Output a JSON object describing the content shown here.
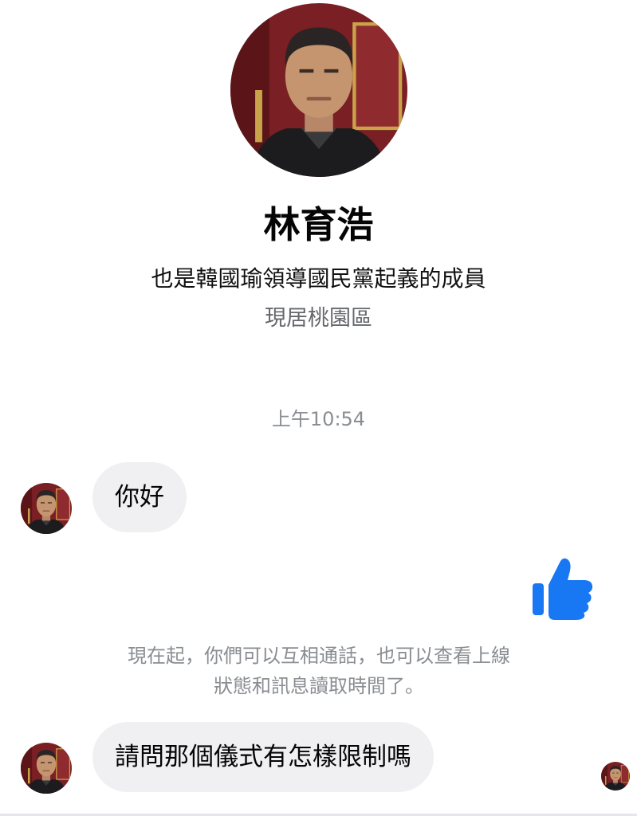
{
  "profile": {
    "name": "林育浩",
    "bio": "也是韓國瑜領導國民黨起義的成員",
    "location": "現居桃園區"
  },
  "conversation": {
    "timestamp": "上午10:54",
    "messages": [
      {
        "sender": "contact",
        "text": "你好"
      },
      {
        "sender": "contact",
        "text": "請問那個儀式有怎樣限制嗎"
      }
    ],
    "sent_reaction_icon": "thumbs-up-icon",
    "system_notice_line1": "現在起，你們可以互相通話，也可以查看上線",
    "system_notice_line2": "狀態和訊息讀取時間了。"
  },
  "colors": {
    "accent": "#1877f2",
    "bubble_bg": "#f0f0f2",
    "muted_text": "#8a8d91",
    "avatar_bg": "#7a1f24"
  }
}
